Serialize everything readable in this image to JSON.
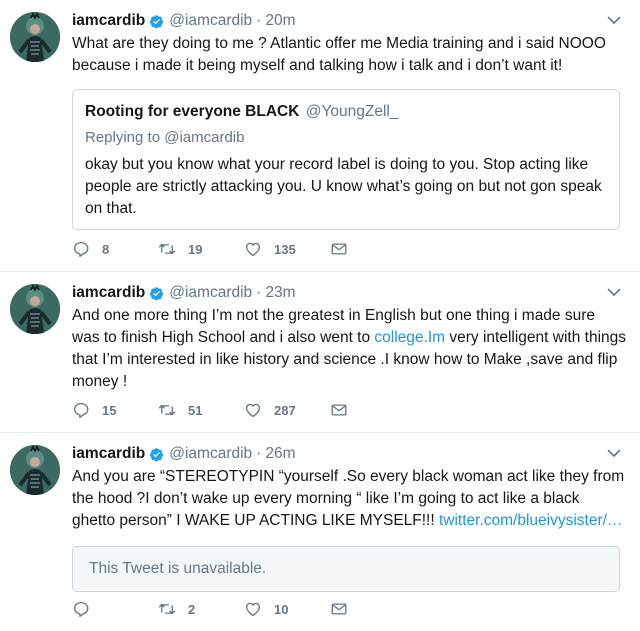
{
  "tweets": [
    {
      "name": "iamcardib",
      "handle": "@iamcardib",
      "separator": "·",
      "time": "20m",
      "text": "What are they doing to me ? Atlantic offer me Media training and i said NOOO because i made it being myself and talking how i talk and i don’t want it!",
      "quote": {
        "name": "Rooting for everyone BLACK",
        "handle": "@YoungZell_",
        "replying_label": "Replying to",
        "replying_handle": "@iamcardib",
        "text": "okay but you know what your record label is doing to you. Stop acting like people are strictly attacking you. U know what’s going on but not gon speak on that."
      },
      "replies": "8",
      "retweets": "19",
      "likes": "135"
    },
    {
      "name": "iamcardib",
      "handle": "@iamcardib",
      "separator": "·",
      "time": "23m",
      "text_before": "And one more thing I’m not the greatest in English but one thing i made sure was to finish High School and i also went to ",
      "link": "college.Im",
      "text_after": " very intelligent with things that I’m interested in like history and science .I know how to Make ,save and flip money !",
      "replies": "15",
      "retweets": "51",
      "likes": "287"
    },
    {
      "name": "iamcardib",
      "handle": "@iamcardib",
      "separator": "·",
      "time": "26m",
      "text": "And you are “STEREOTYPIN “yourself .So every black woman act like they from the hood ?I don’t wake up every morning “ like I’m going to act like a black ghetto person” I WAKE UP ACTING LIKE MYSELF!!! ",
      "link": "twitter.com/blueivysister/…",
      "unavailable": "This Tweet is unavailable.",
      "replies": "",
      "retweets": "2",
      "likes": "10"
    }
  ],
  "icons": {
    "verified": "verified-badge-icon",
    "caret": "chevron-down-icon",
    "reply": "reply-icon",
    "retweet": "retweet-icon",
    "like": "heart-icon",
    "dm": "envelope-icon"
  },
  "colors": {
    "link": "#1b95e0",
    "muted": "#657786",
    "verified": "#1da1f2",
    "border": "#e6ecf0"
  }
}
